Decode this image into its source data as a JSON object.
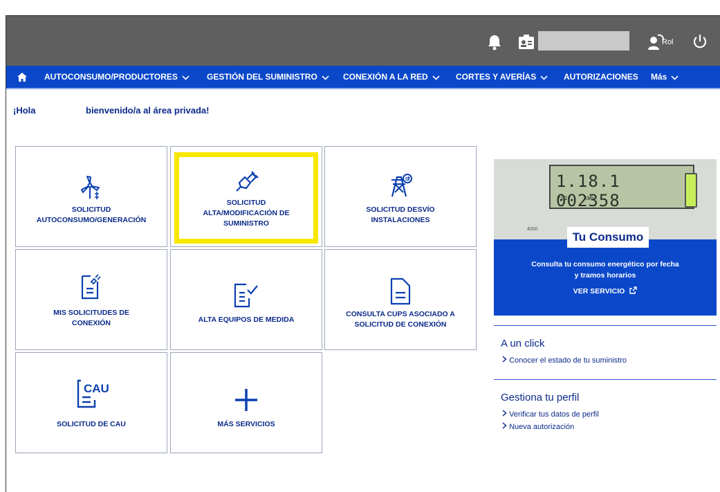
{
  "topbar": {
    "icons": [
      "bell-icon",
      "id-card-icon",
      "person-switch-icon",
      "power-icon"
    ],
    "rol_label": "Rol"
  },
  "nav": {
    "home_icon": "home-icon",
    "items": [
      {
        "label": "AUTOCONSUMO/PRODUCTORES",
        "dropdown": true
      },
      {
        "label": "GESTIÓN DEL SUMINISTRO",
        "dropdown": true
      },
      {
        "label": "CONEXIÓN A LA RED",
        "dropdown": true
      },
      {
        "label": "CORTES Y AVERÍAS",
        "dropdown": true
      },
      {
        "label": "AUTORIZACIONES",
        "dropdown": false
      },
      {
        "label": "Más",
        "dropdown": true
      }
    ]
  },
  "greeting": {
    "hola": "¡Hola",
    "welcome": "bienvenido/a al área privada!"
  },
  "tiles": [
    {
      "icon": "wind-turbine-icon",
      "lines": [
        "SOLICITUD",
        "AUTOCONSUMO/GENERACIÓN"
      ]
    },
    {
      "icon": "plug-icon",
      "lines": [
        "SOLICITUD",
        "ALTA/MODIFICACIÓN DE",
        "SUMINISTRO"
      ],
      "highlighted": true
    },
    {
      "icon": "power-tower-icon",
      "lines": [
        "SOLICITUD DESVÍO",
        "INSTALACIONES"
      ]
    },
    {
      "icon": "document-plug-icon",
      "lines": [
        "MIS SOLICITUDES DE",
        "CONEXIÓN"
      ]
    },
    {
      "icon": "document-check-icon",
      "lines": [
        "ALTA EQUIPOS DE MEDIDA"
      ]
    },
    {
      "icon": "document-icon",
      "lines": [
        "CONSULTA CUPS ASOCIADO A",
        "SOLICITUD DE CONEXIÓN"
      ]
    },
    {
      "icon": "cau-document-icon",
      "icon_text": "CAU",
      "lines": [
        "SOLICITUD DE CAU"
      ]
    },
    {
      "icon": "plus-icon",
      "lines": [
        "MÁS SERVICIOS"
      ]
    }
  ],
  "promo": {
    "meter_display": "1.18.1   002358",
    "meter_small": "*L1*    kWh",
    "meter_label": "4000",
    "title": "Tu Consumo",
    "text_line1": "Consulta tu consumo energético por fecha",
    "text_line2": "y tramos horarios",
    "link": "VER SERVICIO",
    "link_icon": "external-link-icon"
  },
  "quick": {
    "title": "A un click",
    "links": [
      "Conocer el estado de tu suministro"
    ]
  },
  "profile": {
    "title": "Gestiona tu perfil",
    "links": [
      "Verificar tus datos de perfil",
      "Nueva autorización"
    ]
  }
}
